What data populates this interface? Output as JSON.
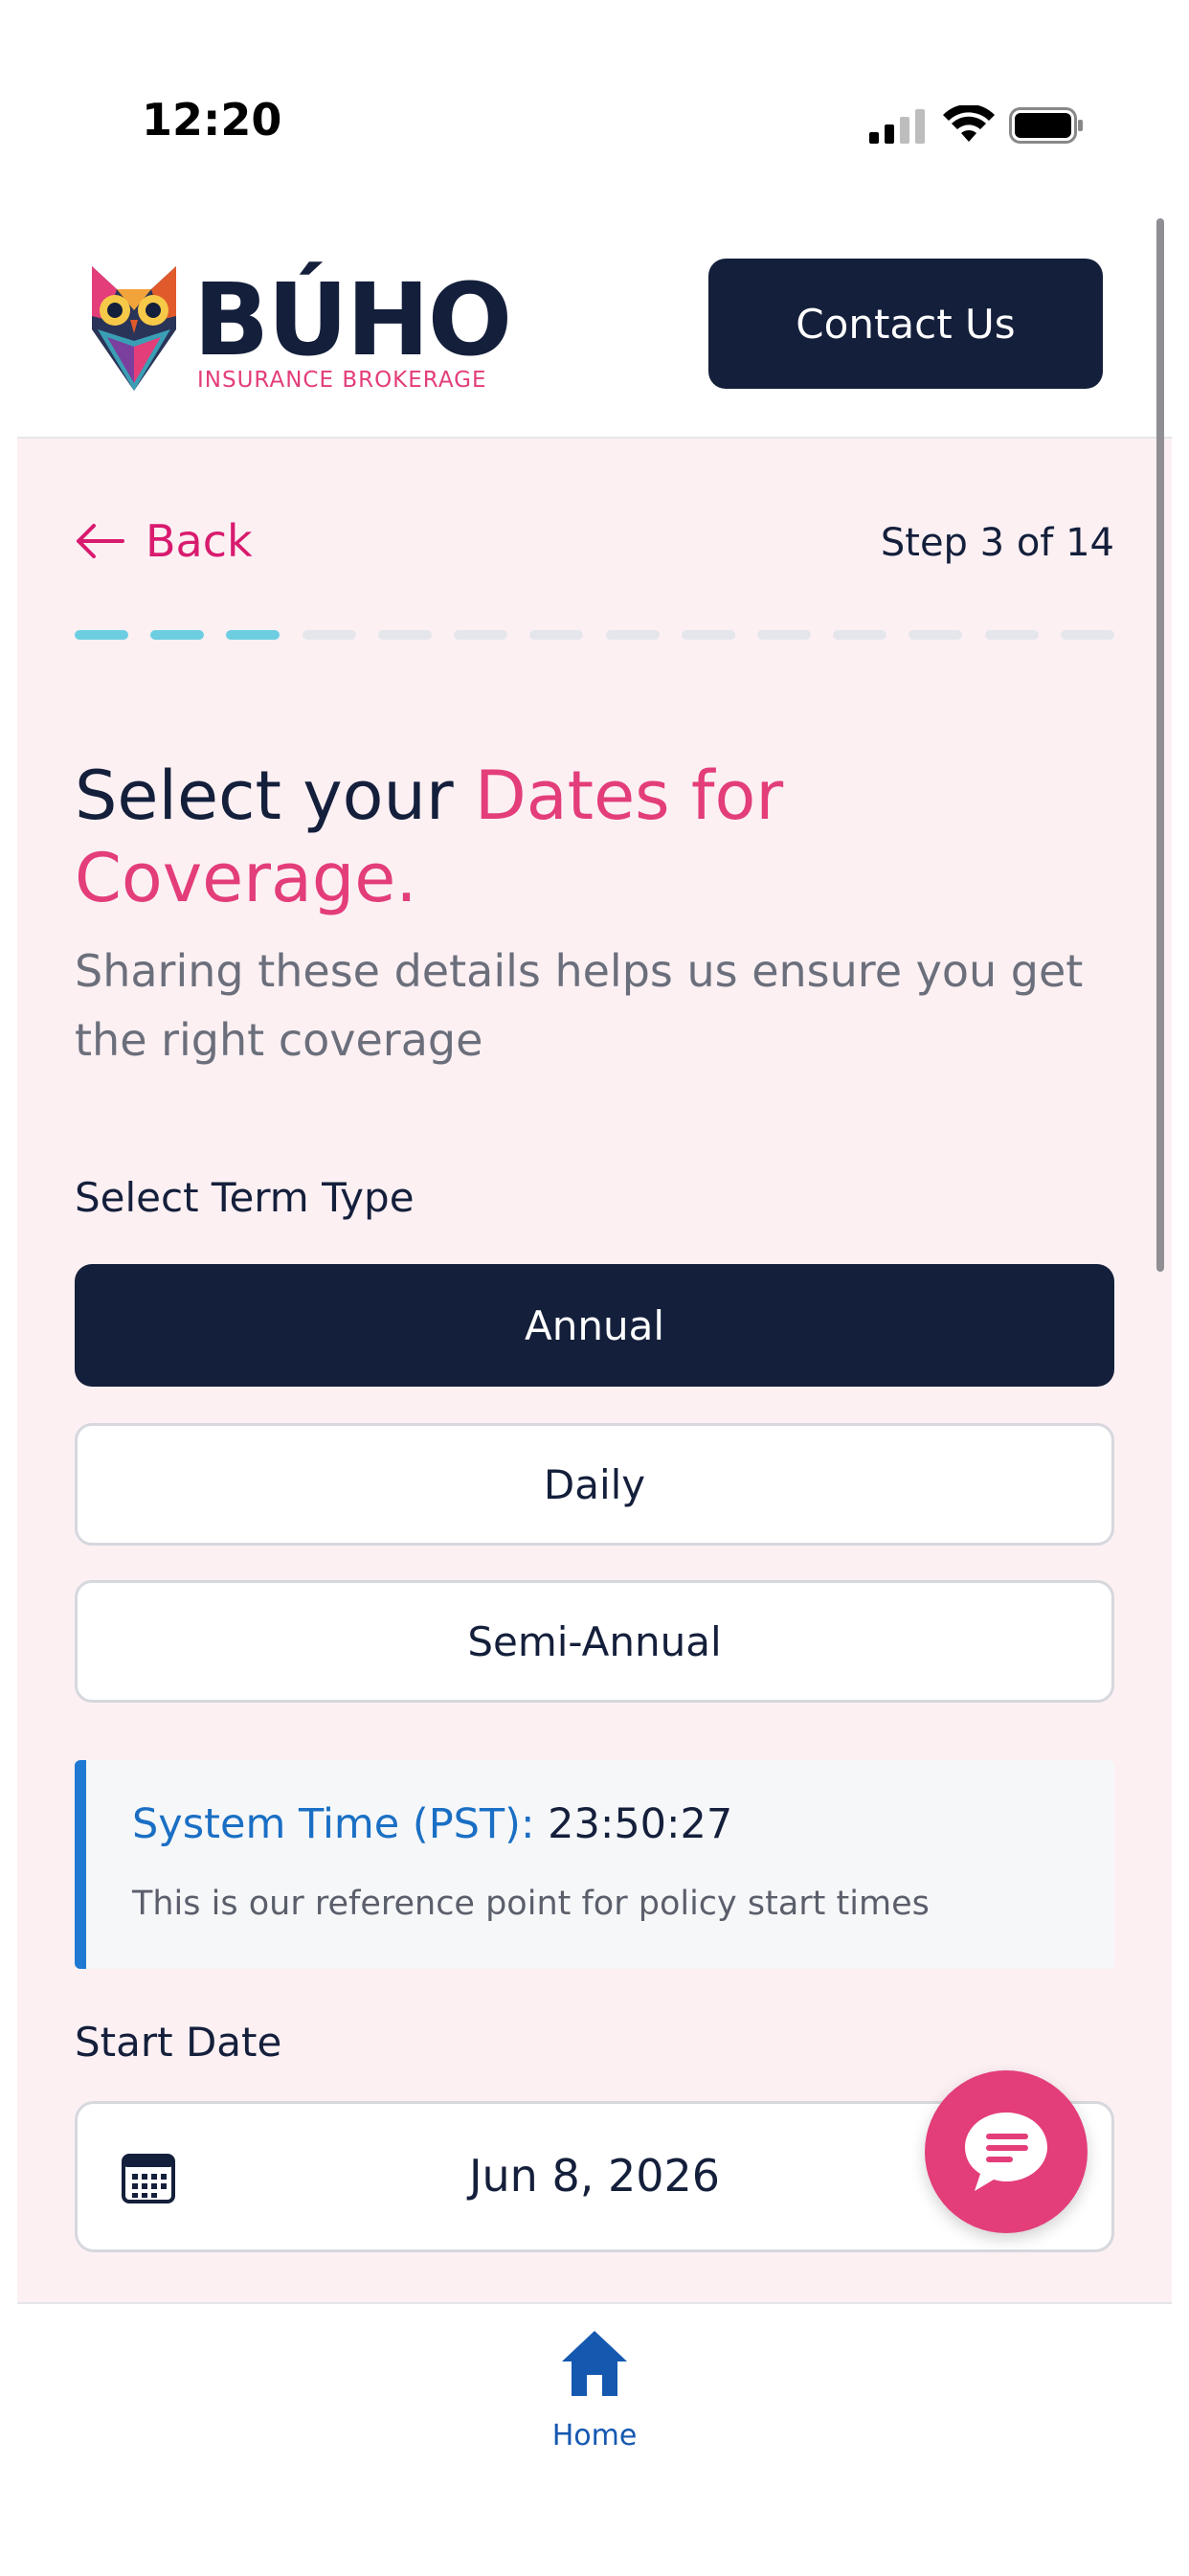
{
  "status_bar": {
    "time": "12:20"
  },
  "header": {
    "brand": "BÚHO",
    "brand_sub": "INSURANCE BROKERAGE",
    "contact_label": "Contact Us"
  },
  "nav": {
    "back_label": "Back",
    "step_text": "Step 3 of 14",
    "current_step": 3,
    "total_steps": 14
  },
  "heading": {
    "prefix": "Select your ",
    "accent": "Dates for Coverage.",
    "subtitle": "Sharing these details helps us ensure you get the right coverage"
  },
  "term": {
    "label": "Select Term Type",
    "options": [
      "Annual",
      "Daily",
      "Semi-Annual"
    ],
    "selected": "Annual"
  },
  "system_time": {
    "label": "System Time (PST):",
    "value": "23:50:27",
    "description": "This is our reference point for policy start times"
  },
  "start_date": {
    "label": "Start Date",
    "value": "Jun 8, 2026"
  },
  "bottom_nav": {
    "home_label": "Home"
  },
  "colors": {
    "navy": "#141f3b",
    "pink": "#e33d7a",
    "progress_active": "#6dcee2",
    "progress_inactive": "#e4e6eb",
    "info_blue": "#1f78d1",
    "page_bg": "#fcf0f3"
  },
  "icons": [
    "signal-icon",
    "wifi-icon",
    "battery-icon",
    "owl-logo-icon",
    "back-arrow-icon",
    "calendar-icon",
    "chat-icon",
    "home-icon"
  ]
}
